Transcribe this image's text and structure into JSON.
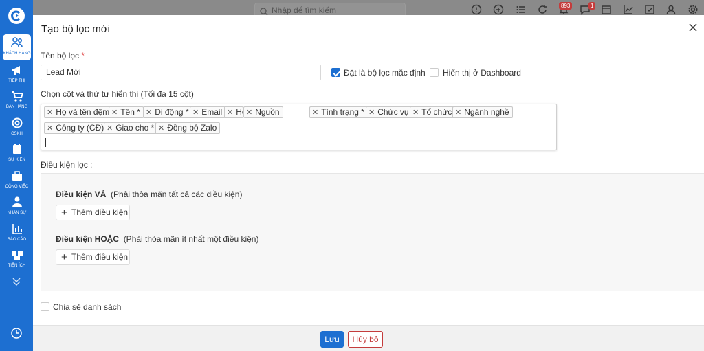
{
  "topbar": {
    "search_placeholder": "Nhập để tìm kiếm",
    "notifications_count": "893",
    "messages_count": "1"
  },
  "sidebar": {
    "items": [
      {
        "label": "KHÁCH HÀNG",
        "icon": "users-icon",
        "active": true
      },
      {
        "label": "TIẾP THỊ",
        "icon": "megaphone-icon"
      },
      {
        "label": "BÁN HÀNG",
        "icon": "cart-icon"
      },
      {
        "label": "CSKH",
        "icon": "lifebuoy-icon"
      },
      {
        "label": "SỰ KIỆN",
        "icon": "calendar-icon"
      },
      {
        "label": "CÔNG VIỆC",
        "icon": "briefcase-icon"
      },
      {
        "label": "NHÂN SỰ",
        "icon": "person-icon"
      },
      {
        "label": "BÁO CÁO",
        "icon": "report-icon"
      },
      {
        "label": "TIỆN ÍCH",
        "icon": "boxes-icon"
      }
    ]
  },
  "modal": {
    "title": "Tạo bộ lọc mới",
    "filter_name_label": "Tên bộ lọc",
    "required_mark": "*",
    "filter_name_value": "Lead Mới",
    "default_label": "Đặt là bộ lọc mặc định",
    "default_checked": true,
    "dashboard_label": "Hiển thị ở Dashboard",
    "dashboard_checked": false,
    "columns_label": "Chọn cột và thứ tự hiển thị (Tối đa 15 cột)",
    "columns": [
      "Họ và tên đệm",
      "Tên *",
      "Di động *",
      "Email",
      "Họ",
      "Nguồn",
      "Tình trạng *",
      "Chức vụ",
      "Tổ chức",
      "Ngành nghề",
      "Công ty (CĐ)",
      "Giao cho *",
      "Đồng bộ Zalo"
    ],
    "conditions_label": "Điều kiện lọc :",
    "and_title": "Điều kiện VÀ",
    "and_desc": "(Phải thỏa mãn tất cả các điều kiện)",
    "or_title": "Điều kiện HOẶC",
    "or_desc": "(Phải thỏa mãn ít nhất một điều kiện)",
    "add_condition_label": "Thêm điều kiện",
    "share_label": "Chia sẻ danh sách",
    "share_checked": false,
    "save_label": "Lưu",
    "cancel_label": "Hủy bỏ"
  },
  "colors": {
    "primary": "#1d6fd1",
    "danger": "#c43c3c"
  }
}
